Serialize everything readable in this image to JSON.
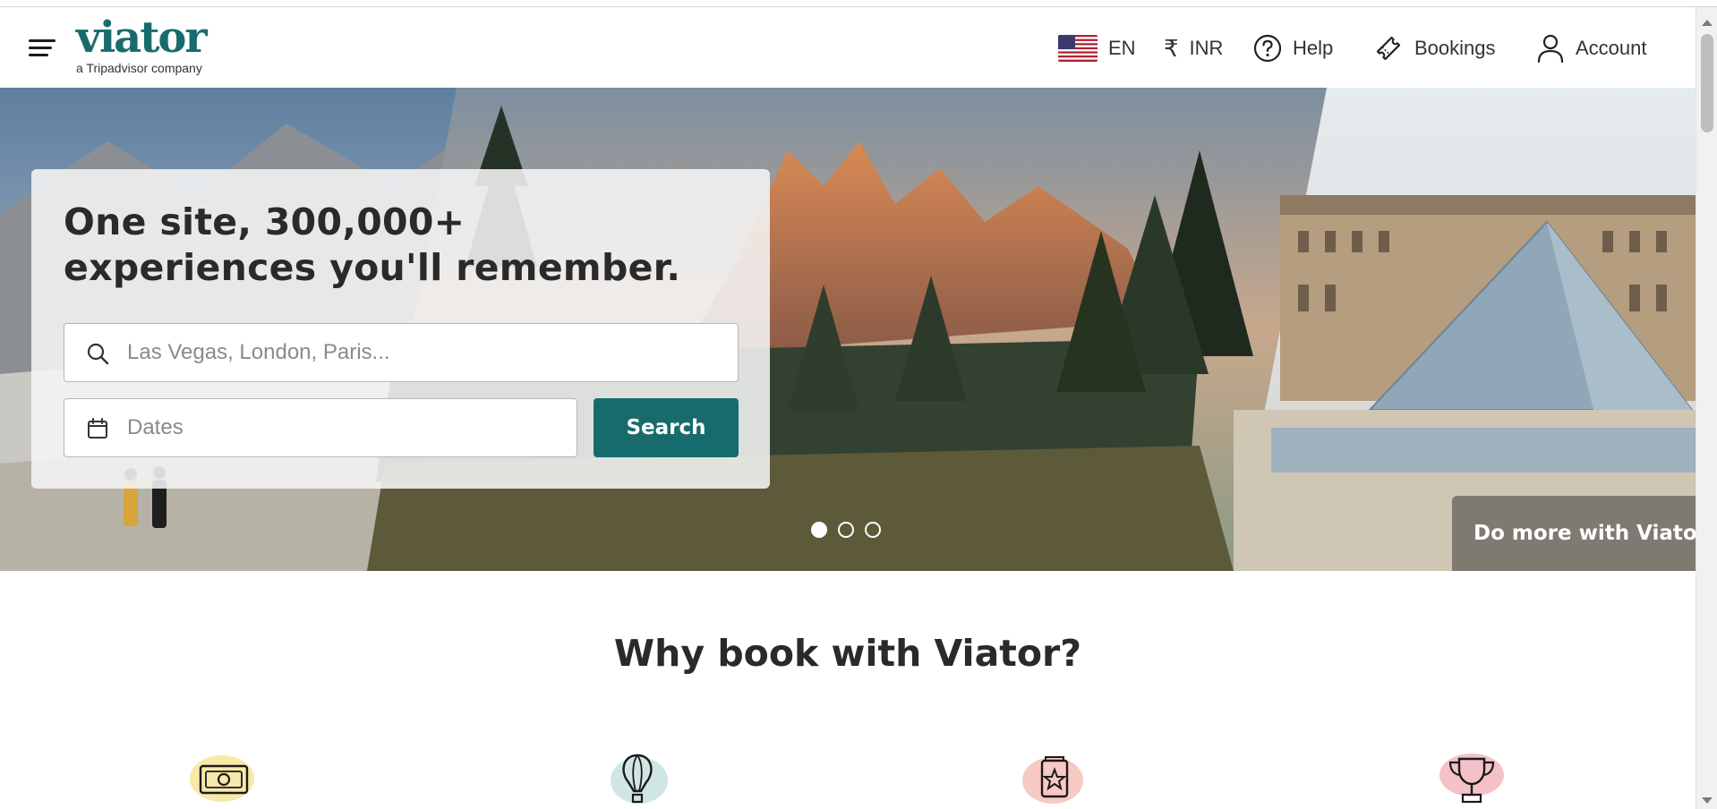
{
  "header": {
    "logo_text": "viator",
    "logo_tagline": "a Tripadvisor company",
    "language": "EN",
    "currency": "INR",
    "help_label": "Help",
    "bookings_label": "Bookings",
    "account_label": "Account"
  },
  "hero": {
    "title": "One site, 300,000+ experiences you'll remember.",
    "search_placeholder": "Las Vegas, London, Paris...",
    "dates_placeholder": "Dates",
    "search_button": "Search",
    "carousel_slides": 3,
    "carousel_active": 1,
    "promo_text": "Do more with Viator"
  },
  "why_section": {
    "heading": "Why book with Viator?",
    "features": [
      {
        "icon": "money-icon",
        "accent": "#f7e9a8"
      },
      {
        "icon": "hot-air-balloon-icon",
        "accent": "#cfe6e4"
      },
      {
        "icon": "star-passport-icon",
        "accent": "#f8c9c2"
      },
      {
        "icon": "trophy-icon",
        "accent": "#f6c0c8"
      }
    ]
  },
  "colors": {
    "brand": "#186b6d",
    "text": "#2a2a2a"
  }
}
